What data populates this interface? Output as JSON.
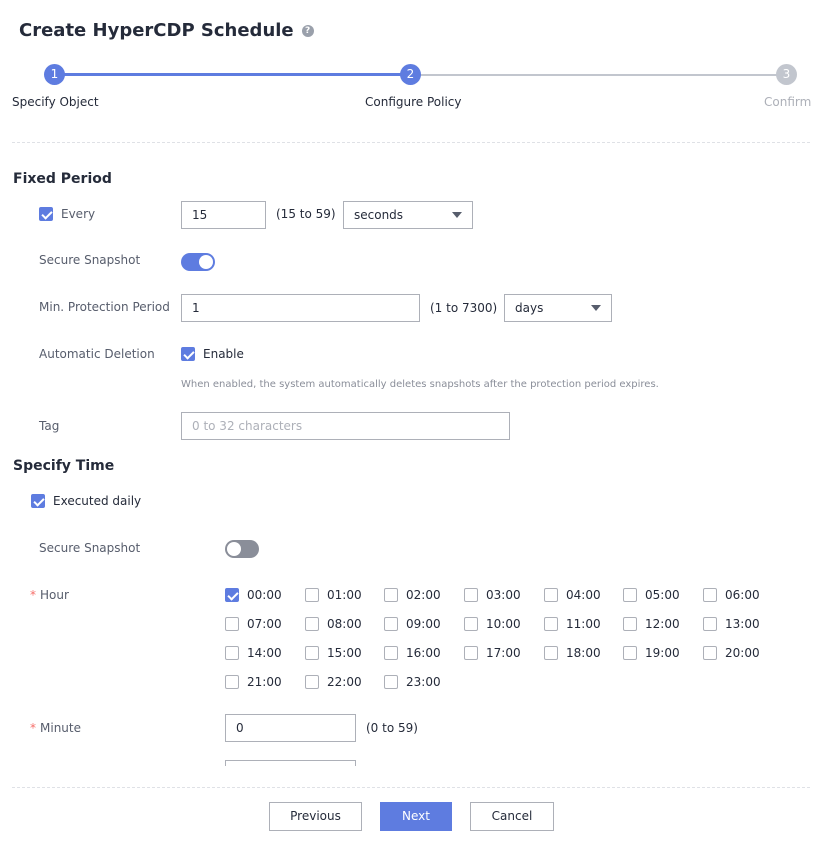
{
  "title": "Create HyperCDP Schedule",
  "steps": [
    {
      "num": "1",
      "label": "Specify Object"
    },
    {
      "num": "2",
      "label": "Configure Policy"
    },
    {
      "num": "3",
      "label": "Confirm"
    }
  ],
  "fixed_period": {
    "heading": "Fixed Period",
    "every_label": "Every",
    "every_checked": true,
    "every_value": "15",
    "every_range": "(15 to 59)",
    "every_unit": "seconds",
    "secure_snapshot_label": "Secure Snapshot",
    "secure_snapshot_on": true,
    "min_protection_label": "Min. Protection Period",
    "min_protection_value": "1",
    "min_protection_range": "(1 to 7300)",
    "min_protection_unit": "days",
    "auto_delete_label": "Automatic Deletion",
    "auto_delete_enable": "Enable",
    "auto_delete_checked": true,
    "auto_delete_hint": "When enabled, the system automatically deletes snapshots after the protection period expires.",
    "tag_label": "Tag",
    "tag_placeholder": "0 to 32 characters"
  },
  "specify_time": {
    "heading": "Specify Time",
    "executed_daily_label": "Executed daily",
    "executed_daily_checked": true,
    "secure_snapshot_label": "Secure Snapshot",
    "secure_snapshot_on": false,
    "hour_label": "Hour",
    "hours": [
      {
        "label": "00:00",
        "checked": true
      },
      {
        "label": "01:00",
        "checked": false
      },
      {
        "label": "02:00",
        "checked": false
      },
      {
        "label": "03:00",
        "checked": false
      },
      {
        "label": "04:00",
        "checked": false
      },
      {
        "label": "05:00",
        "checked": false
      },
      {
        "label": "06:00",
        "checked": false
      },
      {
        "label": "07:00",
        "checked": false
      },
      {
        "label": "08:00",
        "checked": false
      },
      {
        "label": "09:00",
        "checked": false
      },
      {
        "label": "10:00",
        "checked": false
      },
      {
        "label": "11:00",
        "checked": false
      },
      {
        "label": "12:00",
        "checked": false
      },
      {
        "label": "13:00",
        "checked": false
      },
      {
        "label": "14:00",
        "checked": false
      },
      {
        "label": "15:00",
        "checked": false
      },
      {
        "label": "16:00",
        "checked": false
      },
      {
        "label": "17:00",
        "checked": false
      },
      {
        "label": "18:00",
        "checked": false
      },
      {
        "label": "19:00",
        "checked": false
      },
      {
        "label": "20:00",
        "checked": false
      },
      {
        "label": "21:00",
        "checked": false
      },
      {
        "label": "22:00",
        "checked": false
      },
      {
        "label": "23:00",
        "checked": false
      }
    ],
    "minute_label": "Minute",
    "minute_value": "0",
    "minute_range": "(0 to 59)"
  },
  "buttons": {
    "previous": "Previous",
    "next": "Next",
    "cancel": "Cancel"
  },
  "colors": {
    "accent": "#5e7ce0",
    "required": "#f66f6a"
  }
}
